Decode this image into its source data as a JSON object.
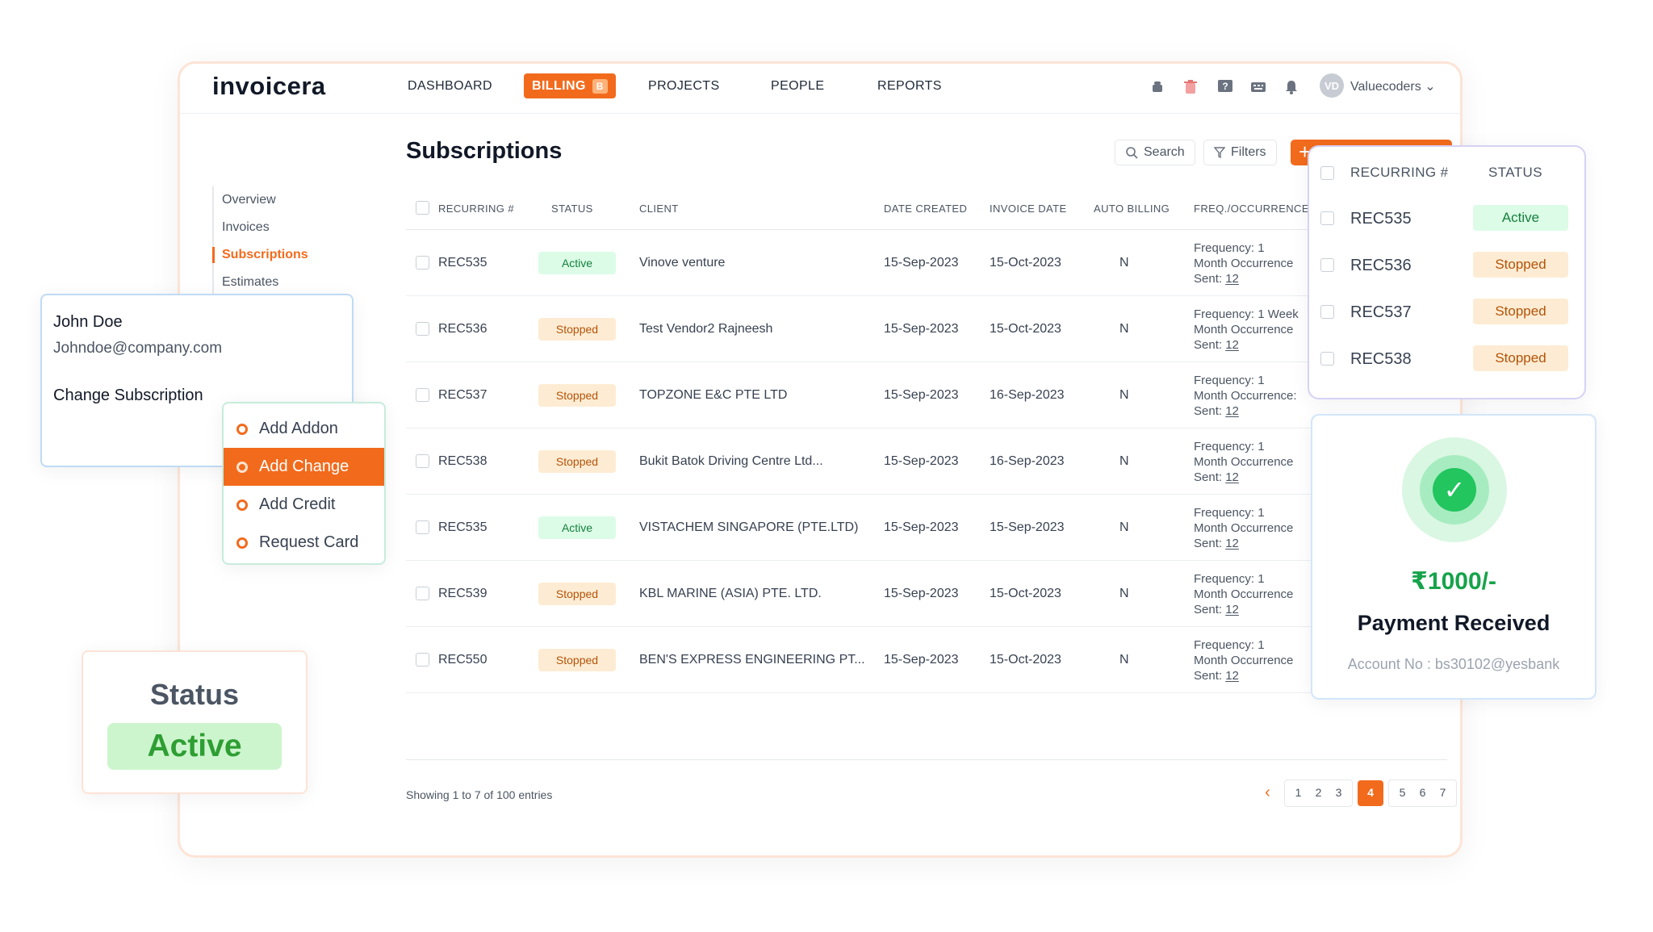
{
  "brand": {
    "logo": "invoicera"
  },
  "nav": {
    "items": [
      "DASHBOARD",
      "PROJECTS",
      "PEOPLE",
      "REPORTS"
    ],
    "billing_label": "BILLING",
    "billing_badge": "B"
  },
  "user": {
    "avatar_initials": "VD",
    "name": "Valuecoders ⌄"
  },
  "icons": [
    "android-icon",
    "trash-icon",
    "help-icon",
    "keyboard-icon",
    "bell-icon"
  ],
  "sidebar": {
    "items": [
      {
        "label": "Overview"
      },
      {
        "label": "Invoices"
      },
      {
        "label": "Subscriptions"
      },
      {
        "label": "Estimates"
      }
    ]
  },
  "page": {
    "title": "Subscriptions"
  },
  "toolbar": {
    "search_label": "Search",
    "filters_label": "Filters",
    "add_label": "+"
  },
  "table": {
    "headers": [
      "RECURRING #",
      "STATUS",
      "CLIENT",
      "DATE CREATED",
      "INVOICE DATE",
      "AUTO BILLING",
      "FREQ./OCCURRENCE"
    ],
    "rows": [
      {
        "id": "REC535",
        "status": "Active",
        "client": "Vinove venture",
        "created": "15-Sep-2023",
        "invoice": "15-Oct-2023",
        "auto": "N",
        "freq1": "Frequency: 1",
        "freq2": "Month Occurrence",
        "sent_label": "Sent:",
        "sent": "12"
      },
      {
        "id": "REC536",
        "status": "Stopped",
        "client": "Test Vendor2 Rajneesh",
        "created": "15-Sep-2023",
        "invoice": "15-Oct-2023",
        "auto": "N",
        "freq1": "Frequency: 1 Week",
        "freq2": "Month Occurrence",
        "sent_label": "Sent:",
        "sent": "12"
      },
      {
        "id": "REC537",
        "status": "Stopped",
        "client": "TOPZONE E&C PTE LTD",
        "created": "15-Sep-2023",
        "invoice": "16-Sep-2023",
        "auto": "N",
        "freq1": "Frequency: 1",
        "freq2": "Month Occurrence:",
        "sent_label": "Sent:",
        "sent": "12"
      },
      {
        "id": "REC538",
        "status": "Stopped",
        "client": "Bukit Batok Driving Centre Ltd...",
        "created": "15-Sep-2023",
        "invoice": "16-Sep-2023",
        "auto": "N",
        "freq1": "Frequency: 1",
        "freq2": "Month Occurrence",
        "sent_label": "Sent:",
        "sent": "12"
      },
      {
        "id": "REC535",
        "status": "Active",
        "client": "VISTACHEM SINGAPORE (PTE.LTD)",
        "created": "15-Sep-2023",
        "invoice": "15-Sep-2023",
        "auto": "N",
        "freq1": "Frequency: 1",
        "freq2": "Month Occurrence",
        "sent_label": "Sent:",
        "sent": "12"
      },
      {
        "id": "REC539",
        "status": "Stopped",
        "client": "KBL MARINE (ASIA) PTE. LTD.",
        "created": "15-Sep-2023",
        "invoice": "15-Oct-2023",
        "auto": "N",
        "freq1": "Frequency: 1",
        "freq2": "Month Occurrence",
        "sent_label": "Sent:",
        "sent": "12"
      },
      {
        "id": "REC550",
        "status": "Stopped",
        "client": "BEN'S EXPRESS ENGINEERING PT...",
        "created": "15-Sep-2023",
        "invoice": "15-Oct-2023",
        "auto": "N",
        "freq1": "Frequency: 1",
        "freq2": "Month Occurrence",
        "sent_label": "Sent:",
        "sent": "12"
      }
    ]
  },
  "footer": {
    "showing": "Showing 1 to 7 of 100 entries"
  },
  "pagination": {
    "prev": "‹",
    "pages_before": [
      "1",
      "2",
      "3"
    ],
    "current": "4",
    "pages_after": [
      "5",
      "6",
      "7"
    ]
  },
  "user_card": {
    "name": "John Doe",
    "email": "Johndoe@company.com",
    "action": "Change Subscription"
  },
  "menu": {
    "items": [
      "Add Addon",
      "Add Change",
      "Add Credit",
      "Request Card"
    ],
    "selected_index": 1
  },
  "status_card": {
    "label": "Status",
    "value": "Active"
  },
  "rec_card": {
    "headers": [
      "RECURRING #",
      "STATUS"
    ],
    "rows": [
      {
        "id": "REC535",
        "status": "Active"
      },
      {
        "id": "REC536",
        "status": "Stopped"
      },
      {
        "id": "REC537",
        "status": "Stopped"
      },
      {
        "id": "REC538",
        "status": "Stopped"
      }
    ]
  },
  "payment": {
    "amount": "₹1000/-",
    "title": "Payment Received",
    "account": "Account No : bs30102@yesbank"
  },
  "colors": {
    "accent": "#f26b1d",
    "active_bg": "#dcfce7",
    "active_text": "#15803d",
    "stopped_bg": "#fdecd3",
    "stopped_text": "#b45309",
    "success": "#22c55e"
  }
}
